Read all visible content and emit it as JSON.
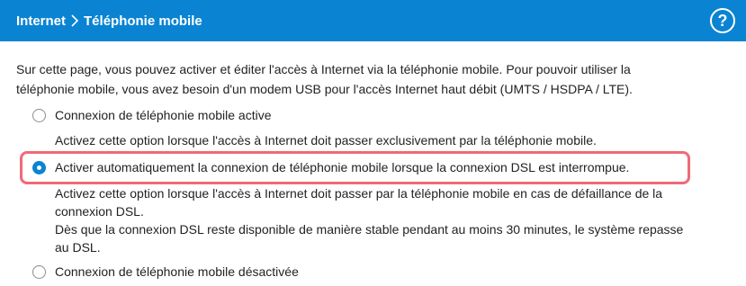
{
  "header": {
    "breadcrumb_root": "Internet",
    "breadcrumb_current": "Téléphonie mobile",
    "help_label": "?"
  },
  "intro": {
    "line1": "Sur cette page, vous pouvez activer et éditer l'accès à Internet via la téléphonie mobile. Pour pouvoir utiliser la",
    "line2": "téléphonie mobile, vous avez besoin d'un modem USB pour l'accès Internet haut débit (UMTS / HSDPA / LTE)."
  },
  "options": [
    {
      "label": "Connexion de téléphonie mobile active",
      "selected": false,
      "description": [
        "Activez cette option lorsque l'accès à Internet doit passer exclusivement par la téléphonie mobile."
      ]
    },
    {
      "label": "Activer automatiquement la connexion de téléphonie mobile lorsque la connexion DSL est interrompue.",
      "selected": true,
      "description": [
        "Activez cette option lorsque l'accès à Internet doit passer par la téléphonie mobile en cas de défaillance de la",
        "connexion DSL.",
        "Dès que la connexion DSL reste disponible de manière stable pendant au moins 30 minutes, le système repasse",
        "au DSL."
      ]
    },
    {
      "label": "Connexion de téléphonie mobile désactivée",
      "selected": false,
      "description": []
    }
  ],
  "colors": {
    "header_bg": "#0a84d2",
    "highlight": "#f06a78",
    "radio_checked": "#0a84d2"
  }
}
